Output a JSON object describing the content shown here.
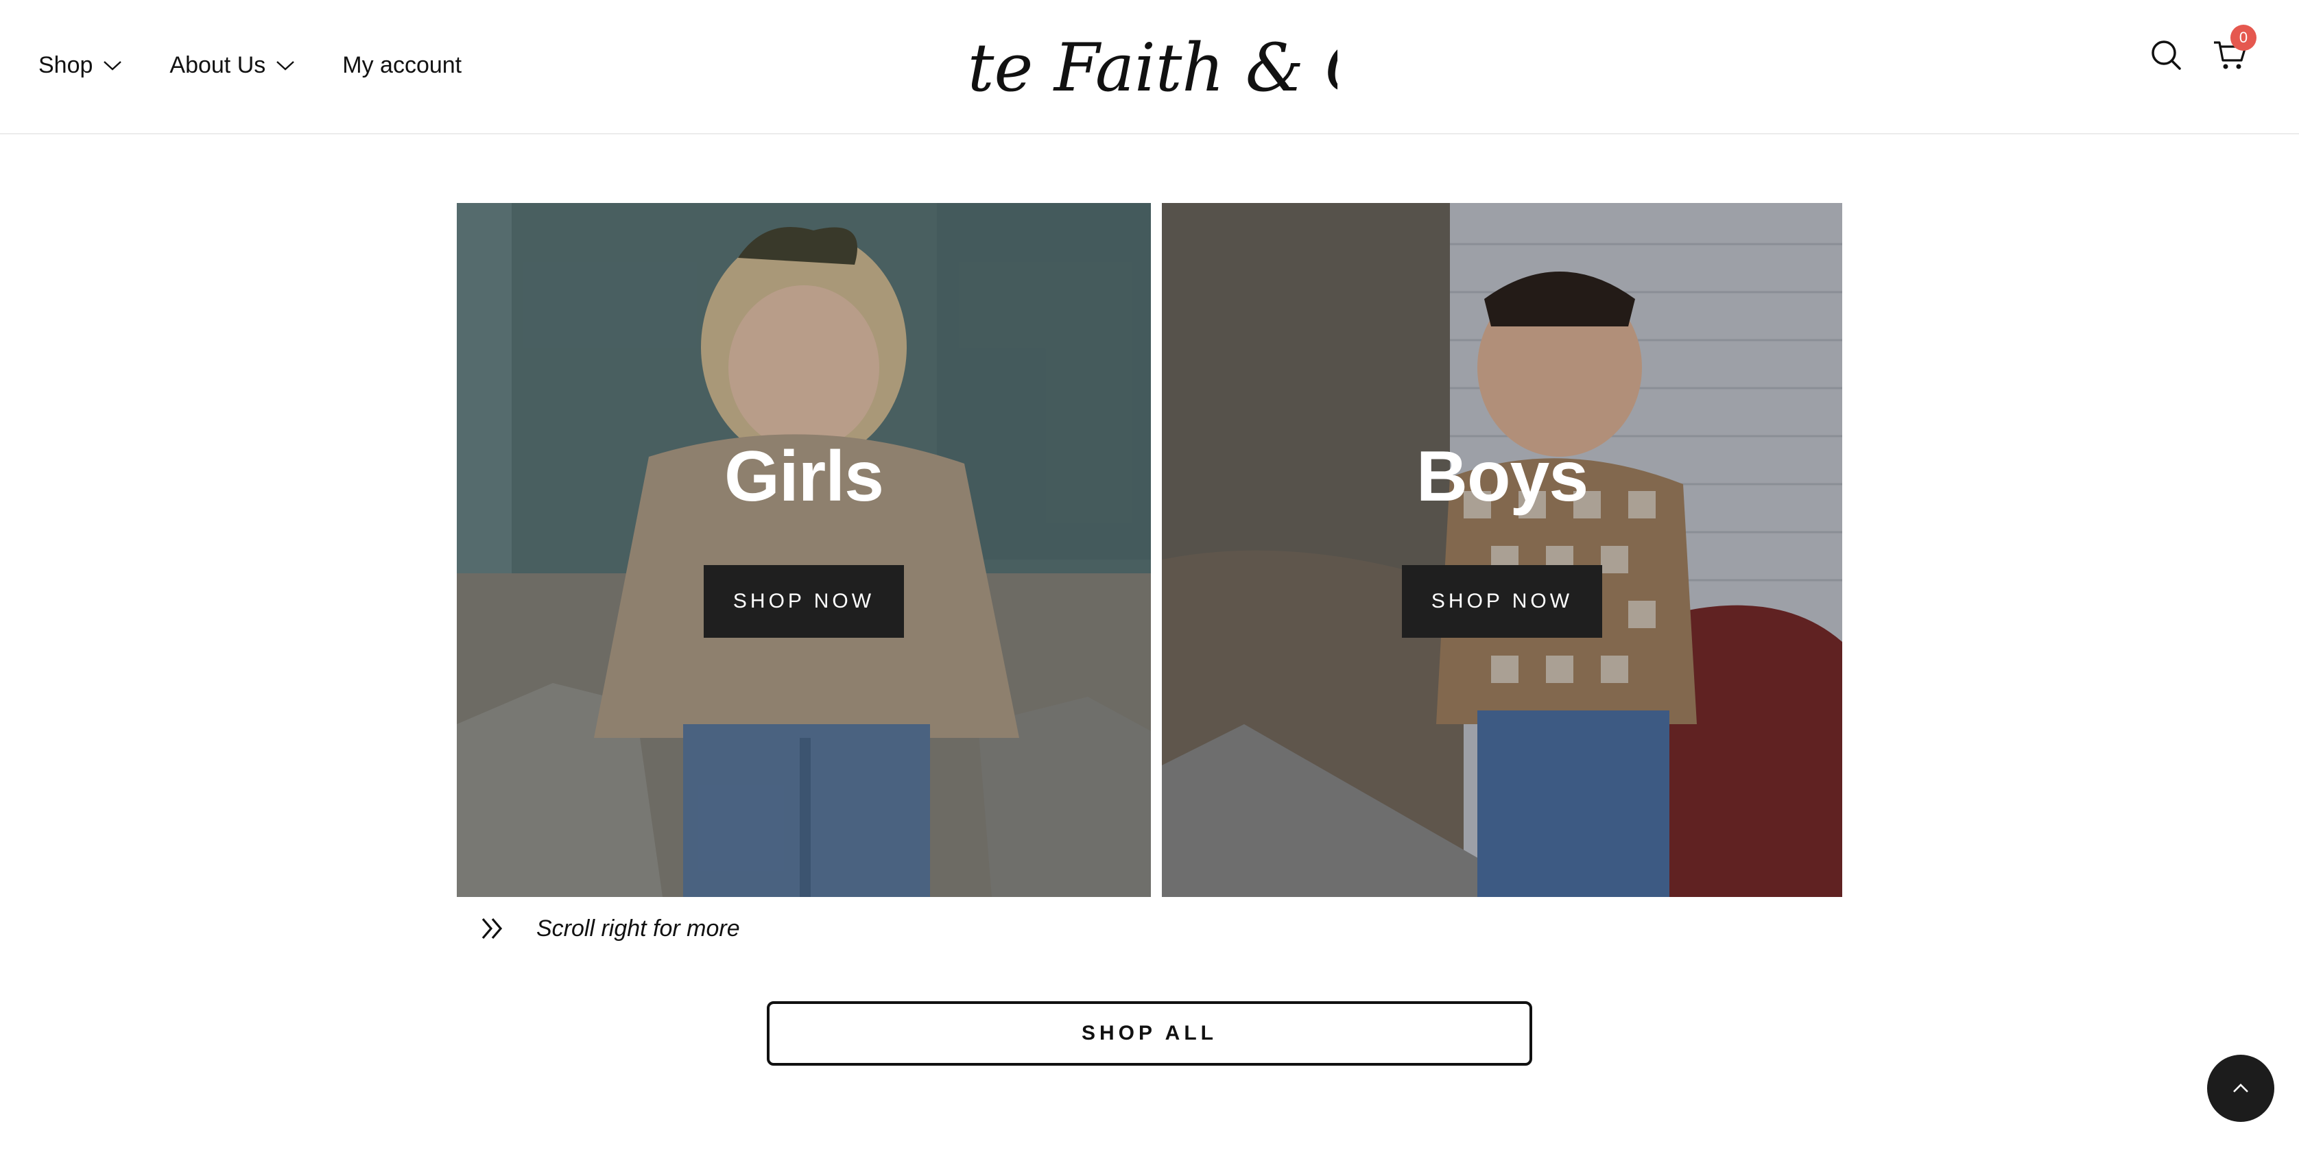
{
  "header": {
    "nav": [
      {
        "label": "Shop",
        "has_dropdown": true
      },
      {
        "label": "About Us",
        "has_dropdown": true
      },
      {
        "label": "My account",
        "has_dropdown": false
      }
    ],
    "logo_text": "Tate Faith & Co",
    "icons": [
      "search-icon",
      "cart-icon"
    ],
    "cart_count": "0"
  },
  "collections": [
    {
      "title": "Girls",
      "button_label": "SHOP NOW"
    },
    {
      "title": "Boys",
      "button_label": "SHOP NOW"
    }
  ],
  "scroll_hint": {
    "icon": "double-chevron-right-icon",
    "text": "Scroll right for more"
  },
  "shop_all_label": "SHOP ALL",
  "back_to_top_icon": "chevron-up-icon",
  "colors": {
    "badge": "#e5584f",
    "button_dark": "#1f1f1f",
    "text": "#111111"
  }
}
